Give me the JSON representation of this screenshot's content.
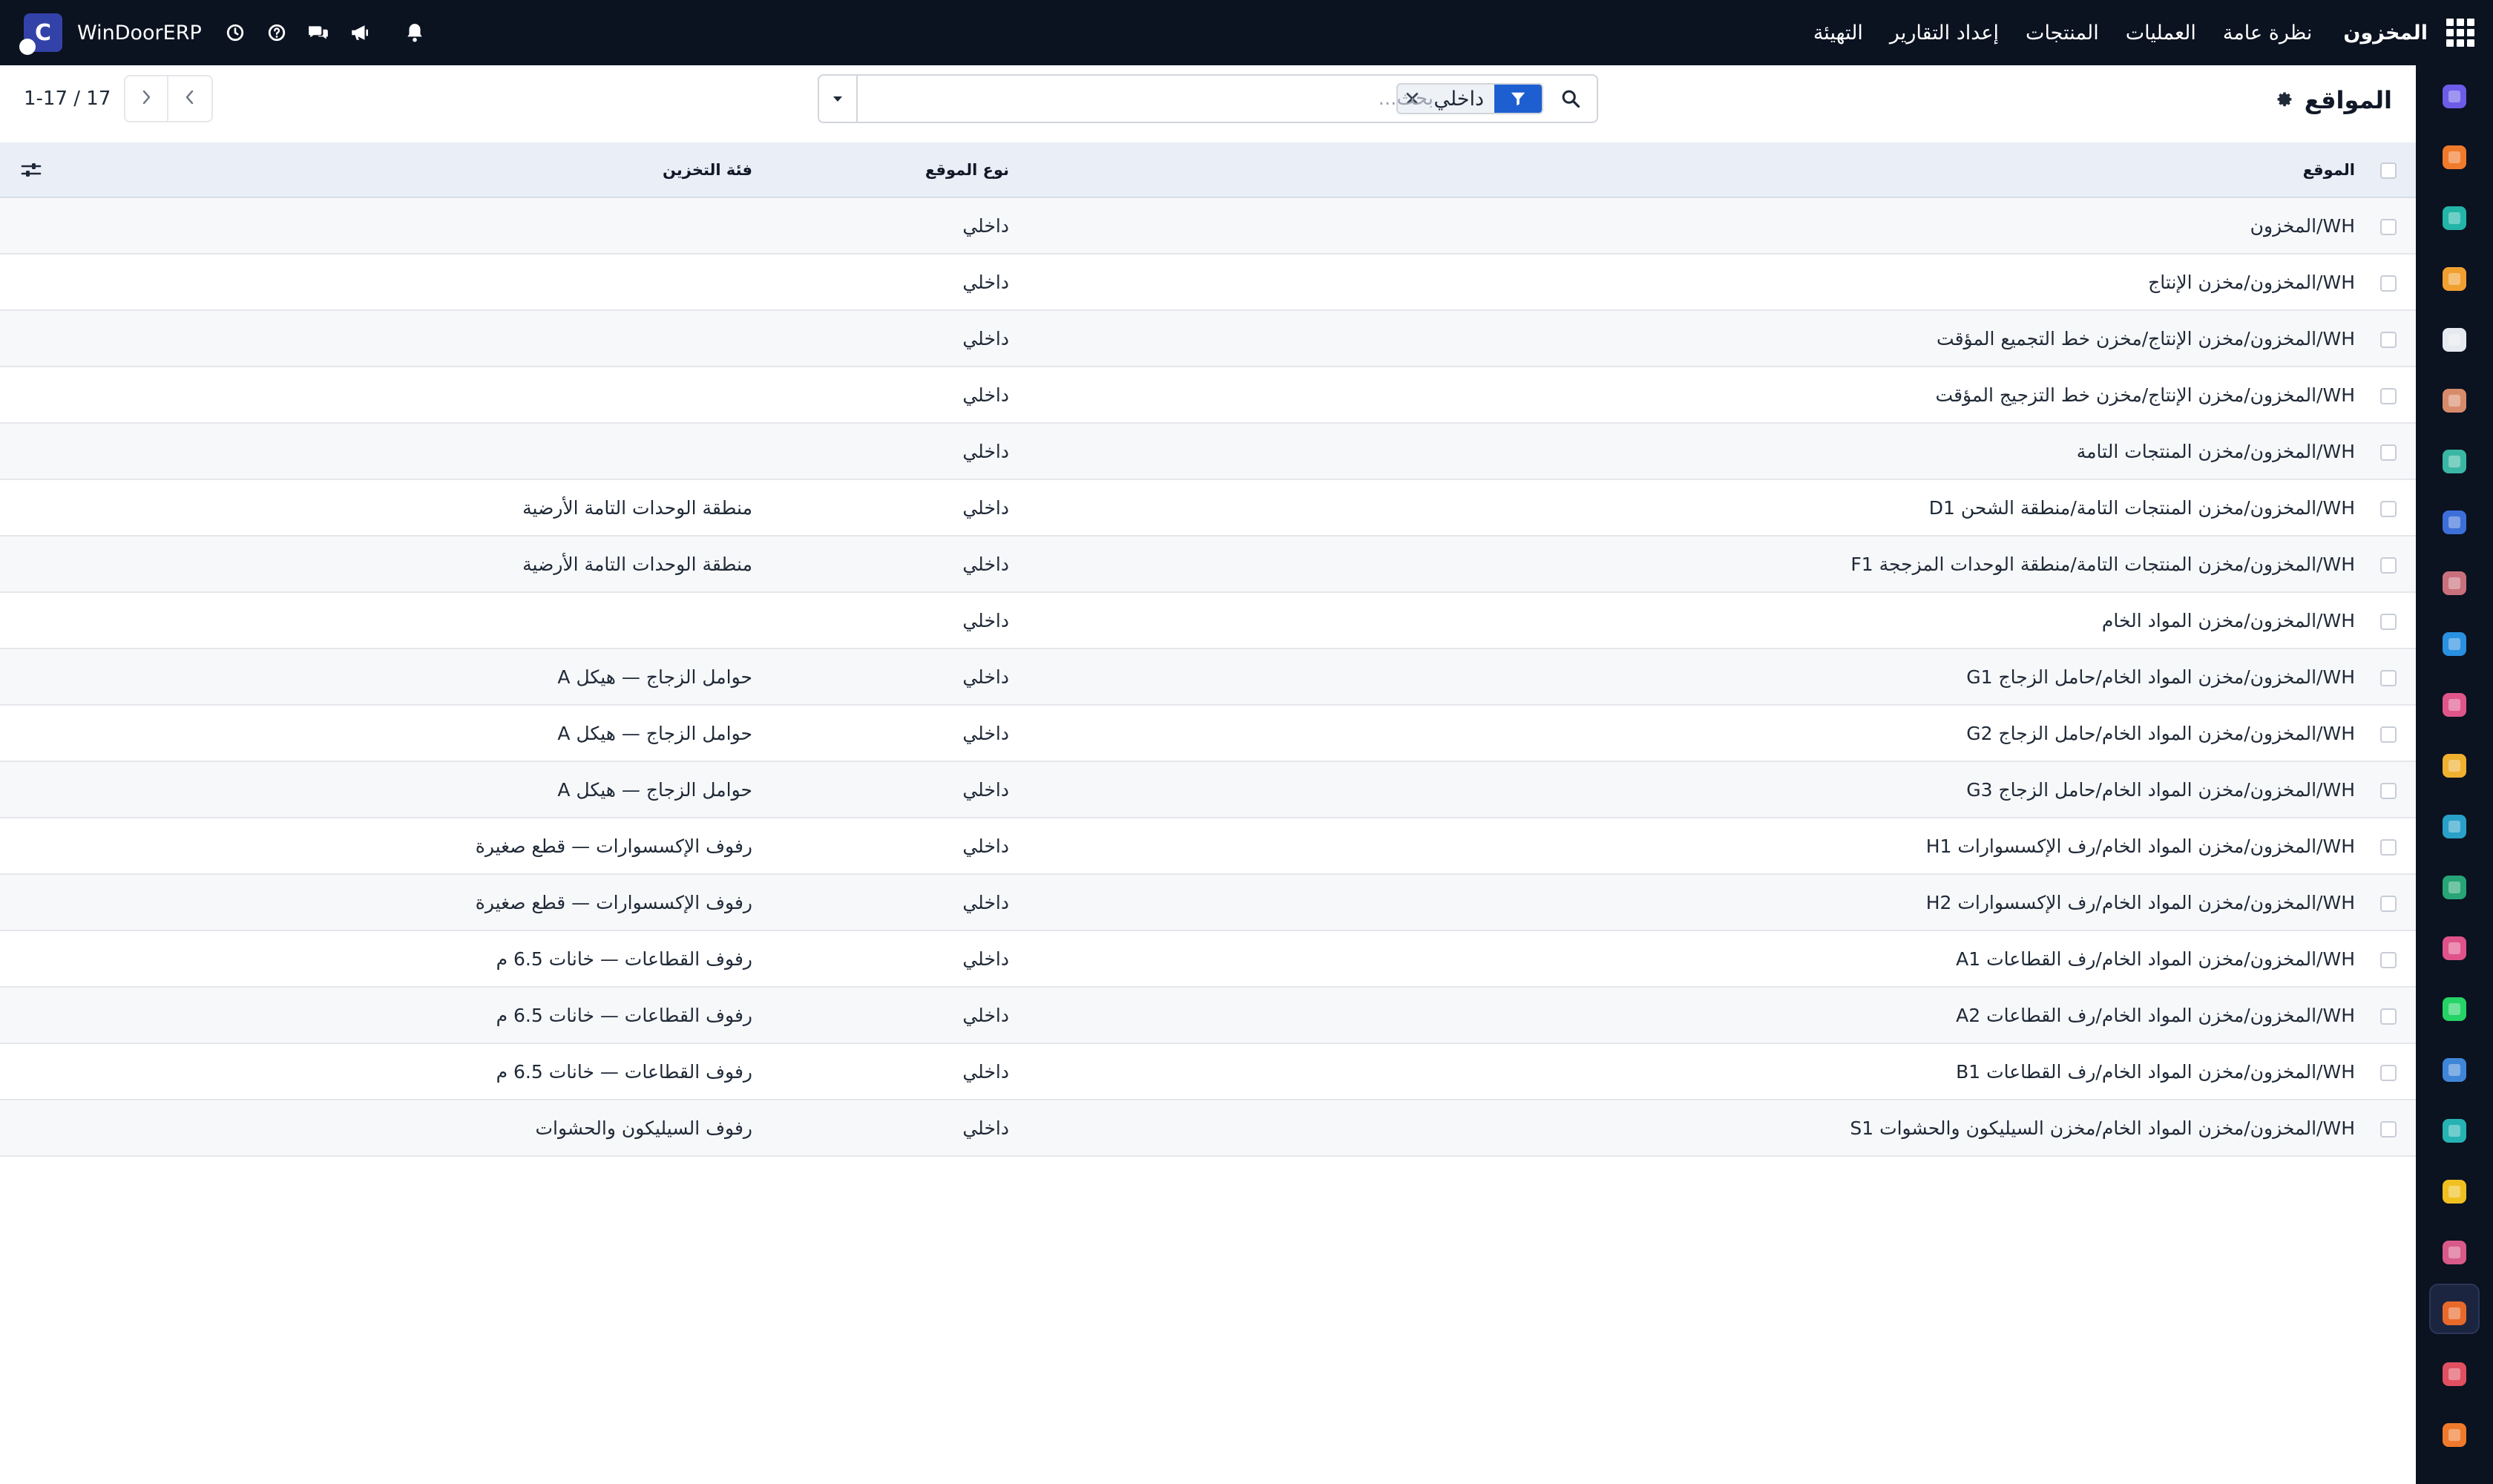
{
  "navbar": {
    "app_name": "المخزون",
    "menu": [
      "نظرة عامة",
      "العمليات",
      "المنتجات",
      "إعداد التقارير",
      "التهيئة"
    ],
    "company_name": "WinDoorERP",
    "company_logo_letter": "C",
    "icons": [
      "apps-grid-icon",
      "clock-icon",
      "help-icon",
      "chat-icon",
      "megaphone-icon",
      "bell-icon"
    ]
  },
  "page": {
    "title": "المواقع"
  },
  "search": {
    "facet_value": "داخلي",
    "placeholder": "بحث..."
  },
  "pager": {
    "value": "1-17 / 17"
  },
  "table": {
    "headers": {
      "location": "الموقع",
      "location_type": "نوع الموقع",
      "storage_category": "فئة التخزين"
    },
    "rows": [
      {
        "location": "WH/المخزون",
        "type": "داخلي",
        "category": ""
      },
      {
        "location": "WH/المخزون/مخزن الإنتاج",
        "type": "داخلي",
        "category": ""
      },
      {
        "location": "WH/المخزون/مخزن الإنتاج/مخزن خط التجميع المؤقت",
        "type": "داخلي",
        "category": ""
      },
      {
        "location": "WH/المخزون/مخزن الإنتاج/مخزن خط التزجيج المؤقت",
        "type": "داخلي",
        "category": ""
      },
      {
        "location": "WH/المخزون/مخزن المنتجات التامة",
        "type": "داخلي",
        "category": ""
      },
      {
        "location": "WH/المخزون/مخزن المنتجات التامة/منطقة الشحن D1",
        "type": "داخلي",
        "category": "منطقة الوحدات التامة الأرضية"
      },
      {
        "location": "WH/المخزون/مخزن المنتجات التامة/منطقة الوحدات المزججة F1",
        "type": "داخلي",
        "category": "منطقة الوحدات التامة الأرضية"
      },
      {
        "location": "WH/المخزون/مخزن المواد الخام",
        "type": "داخلي",
        "category": ""
      },
      {
        "location": "WH/المخزون/مخزن المواد الخام/حامل الزجاج G1",
        "type": "داخلي",
        "category": "حوامل الزجاج — هيكل A"
      },
      {
        "location": "WH/المخزون/مخزن المواد الخام/حامل الزجاج G2",
        "type": "داخلي",
        "category": "حوامل الزجاج — هيكل A"
      },
      {
        "location": "WH/المخزون/مخزن المواد الخام/حامل الزجاج G3",
        "type": "داخلي",
        "category": "حوامل الزجاج — هيكل A"
      },
      {
        "location": "WH/المخزون/مخزن المواد الخام/رف الإكسسوارات H1",
        "type": "داخلي",
        "category": "رفوف الإكسسوارات — قطع صغيرة"
      },
      {
        "location": "WH/المخزون/مخزن المواد الخام/رف الإكسسوارات H2",
        "type": "داخلي",
        "category": "رفوف الإكسسوارات — قطع صغيرة"
      },
      {
        "location": "WH/المخزون/مخزن المواد الخام/رف القطاعات A1",
        "type": "داخلي",
        "category": "رفوف القطاعات — خانات 6.5 م"
      },
      {
        "location": "WH/المخزون/مخزن المواد الخام/رف القطاعات A2",
        "type": "داخلي",
        "category": "رفوف القطاعات — خانات 6.5 م"
      },
      {
        "location": "WH/المخزون/مخزن المواد الخام/رف القطاعات B1",
        "type": "داخلي",
        "category": "رفوف القطاعات — خانات 6.5 م"
      },
      {
        "location": "WH/المخزون/مخزن المواد الخام/مخزن السيليكون والحشوات S1",
        "type": "داخلي",
        "category": "رفوف السيليكون والحشوات"
      }
    ]
  },
  "sidebar_apps": [
    {
      "name": "mail-app-icon",
      "color": "#6d5ce8"
    },
    {
      "name": "discuss-app-icon",
      "color": "#f07a2b"
    },
    {
      "name": "crm-app-icon",
      "color": "#22b5a8"
    },
    {
      "name": "sales-app-icon",
      "color": "#f0a030"
    },
    {
      "name": "inventory-cube-icon",
      "color": "#e6e9ef"
    },
    {
      "name": "contacts-app-icon",
      "color": "#d88b6b"
    },
    {
      "name": "project-app-icon",
      "color": "#3ab7a4"
    },
    {
      "name": "knowledge-app-icon",
      "color": "#3d6fd8"
    },
    {
      "name": "barcode-app-icon",
      "color": "#c8717d"
    },
    {
      "name": "invoicing-app-icon",
      "color": "#2a90e0"
    },
    {
      "name": "employees-app-icon",
      "color": "#e0568a"
    },
    {
      "name": "calendar-app-icon",
      "color": "#f0b030"
    },
    {
      "name": "sign-app-icon",
      "color": "#29a0c8"
    },
    {
      "name": "directory-app-icon",
      "color": "#27a577"
    },
    {
      "name": "dashboards-app-icon",
      "color": "#e0538a"
    },
    {
      "name": "whatsapp-app-icon",
      "color": "#25d366"
    },
    {
      "name": "timer-app-icon",
      "color": "#3f86d8"
    },
    {
      "name": "website-app-icon",
      "color": "#26b3b3"
    },
    {
      "name": "telegram-app-icon",
      "color": "#f0c020"
    },
    {
      "name": "accounting-app-icon",
      "color": "#d85a88"
    },
    {
      "name": "inventory-app-icon",
      "color": "#e86a2b"
    },
    {
      "name": "reporting-app-icon",
      "color": "#e05060"
    },
    {
      "name": "manufacturing-app-icon",
      "color": "#f07a2b"
    }
  ]
}
